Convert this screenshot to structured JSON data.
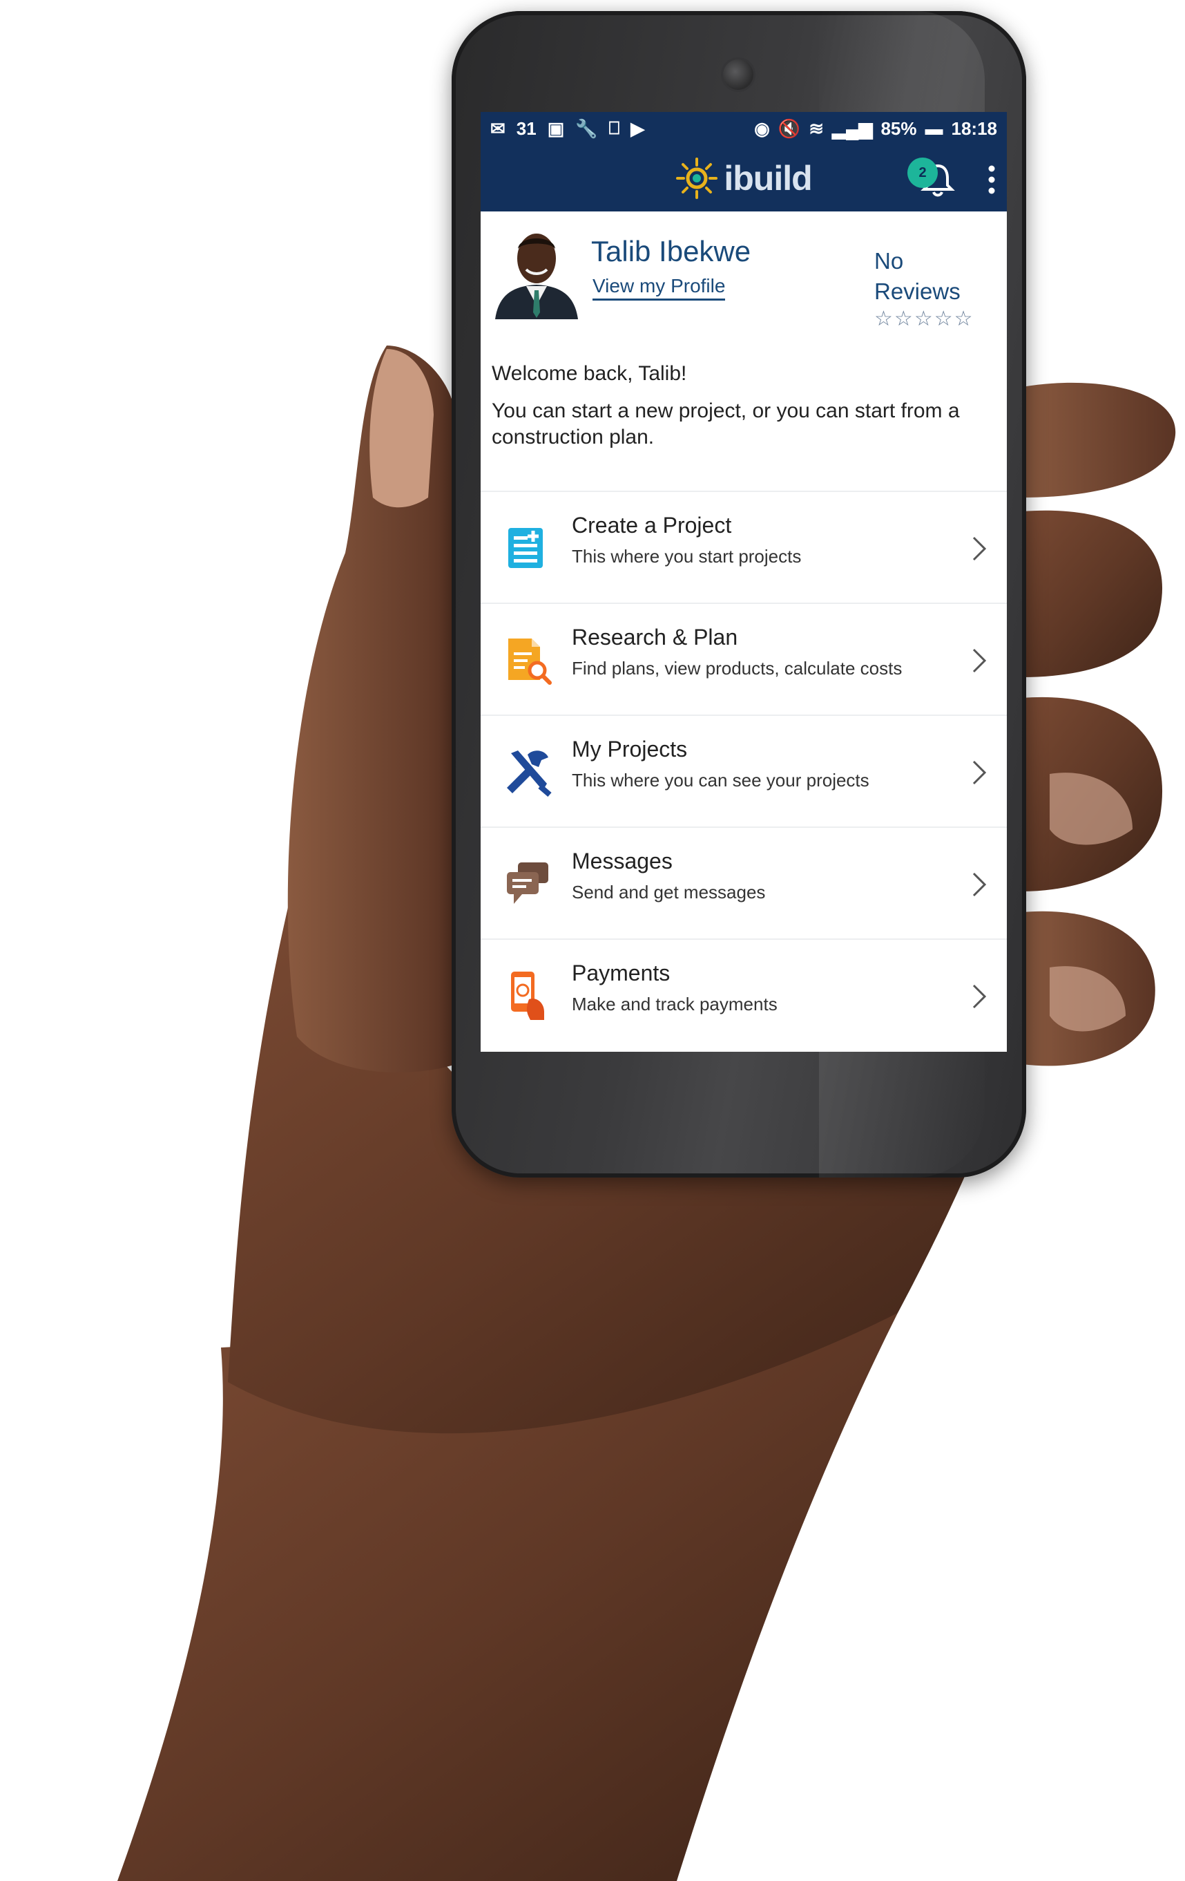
{
  "status_bar": {
    "battery": "85%",
    "time": "18:18",
    "calendar_day": "31"
  },
  "app_bar": {
    "logo_text": "ibuild",
    "notification_count": "2"
  },
  "profile": {
    "name": "Talib Ibekwe",
    "view_profile_link": "View my Profile",
    "reviews_line1": "No",
    "reviews_line2": "Reviews",
    "star_rating": 0
  },
  "welcome": {
    "greeting": "Welcome back, Talib!",
    "intro": "You can start a new project, or you can start from a construction plan."
  },
  "menu": {
    "items": [
      {
        "title": "Create a Project",
        "subtitle": "This where you start projects",
        "icon": "create-project-icon"
      },
      {
        "title": "Research & Plan",
        "subtitle": "Find plans, view products, calculate costs",
        "icon": "research-plan-icon"
      },
      {
        "title": "My Projects",
        "subtitle": "This where you can see your projects",
        "icon": "tools-icon"
      },
      {
        "title": "Messages",
        "subtitle": "Send and get messages",
        "icon": "messages-icon"
      },
      {
        "title": "Payments",
        "subtitle": "Make and track payments",
        "icon": "payments-icon"
      }
    ]
  },
  "colors": {
    "app_bar": "#12305c",
    "accent_teal": "#1db59a",
    "link_blue": "#1a4a7a"
  }
}
